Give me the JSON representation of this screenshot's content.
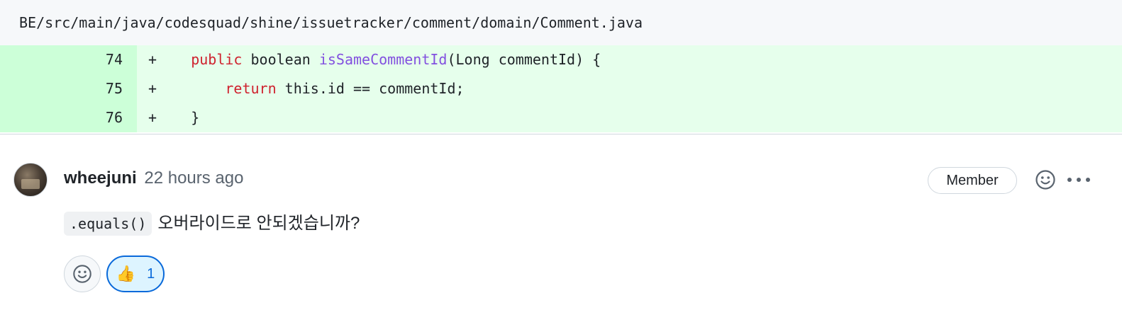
{
  "file": {
    "path": "BE/src/main/java/codesquad/shine/issuetracker/comment/domain/Comment.java"
  },
  "diff": {
    "lines": [
      {
        "number": "74",
        "marker": "+",
        "indent": "    ",
        "kw": "public",
        "mid": " boolean ",
        "fn": "isSameCommentId",
        "rest": "(Long commentId) {"
      },
      {
        "number": "75",
        "marker": "+",
        "indent": "        ",
        "kw": "return",
        "mid": " this.id == commentId;",
        "fn": "",
        "rest": ""
      },
      {
        "number": "76",
        "marker": "+",
        "indent": "    ",
        "kw": "",
        "mid": "}",
        "fn": "",
        "rest": ""
      }
    ]
  },
  "comment": {
    "author": "wheejuni",
    "timestamp": "22 hours ago",
    "badge": "Member",
    "inline_code": ".equals()",
    "text": "오버라이드로 안되겠습니까?",
    "reactions": [
      {
        "emoji": "👍",
        "count": "1"
      }
    ]
  },
  "icons": {
    "emoji_picker": "smiley-icon",
    "more": "kebab-horizontal-icon",
    "reaction": "thumbs-up-icon"
  },
  "colors": {
    "addition_line_number_bg": "#ccffd8",
    "addition_code_bg": "#e6ffec",
    "keyword": "#cf222e",
    "function": "#8250df",
    "reaction_accent": "#0969da"
  }
}
